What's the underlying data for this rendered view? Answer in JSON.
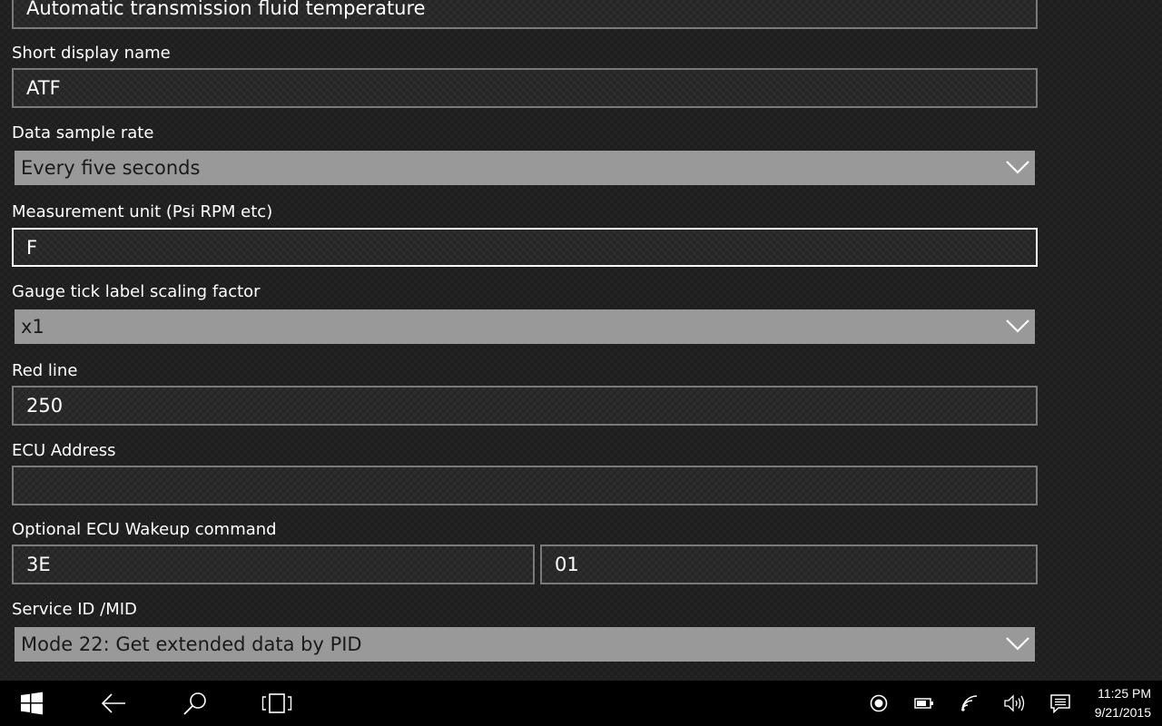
{
  "form": {
    "full_name_value": "Automatic transmission fluid temperature",
    "short_name": {
      "label": "Short display name",
      "value": "ATF"
    },
    "sample_rate": {
      "label": "Data sample rate",
      "selected": "Every five seconds"
    },
    "unit": {
      "label": "Measurement unit (Psi RPM etc)",
      "value": "F"
    },
    "scaling": {
      "label": "Gauge tick label scaling factor",
      "selected": "x1"
    },
    "red_line": {
      "label": "Red line",
      "value": "250"
    },
    "ecu_address": {
      "label": "ECU Address",
      "value": ""
    },
    "wakeup": {
      "label": "Optional ECU Wakeup command",
      "value1": "3E",
      "value2": "01"
    },
    "service_id": {
      "label": "Service ID /MID",
      "selected": "Mode 22: Get extended data by PID"
    }
  },
  "taskbar": {
    "icons": [
      "windows-logo-icon",
      "back-arrow-icon",
      "search-icon",
      "task-view-icon",
      "record-icon",
      "battery-icon",
      "wifi-icon",
      "volume-icon",
      "action-center-icon"
    ],
    "time": "11:25 PM",
    "date": "9/21/2015"
  },
  "colors": {
    "background": "#1e1e1e",
    "textbox_border": "#7a7a7a",
    "focused_border": "#ffffff",
    "combo_background": "#999999",
    "taskbar": "#000000"
  }
}
